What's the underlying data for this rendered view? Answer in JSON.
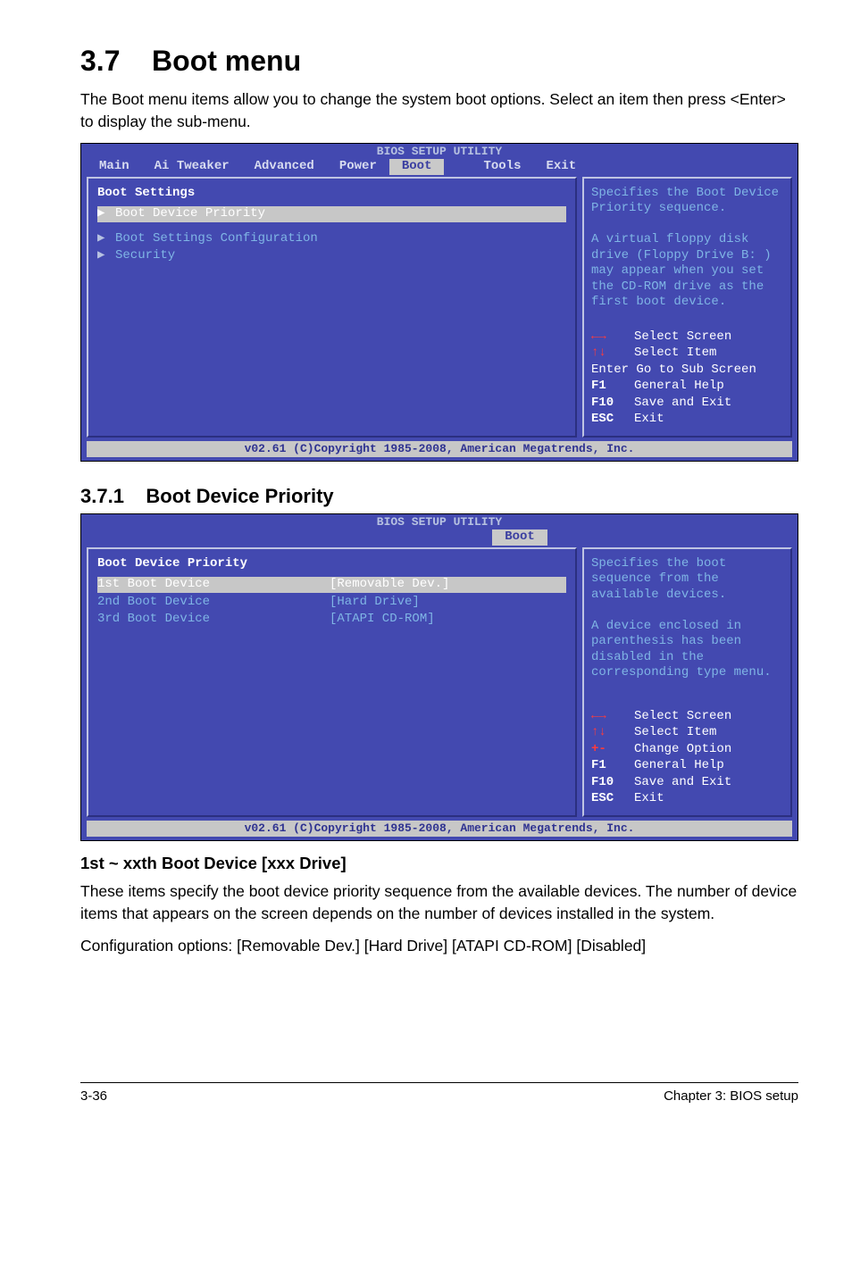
{
  "section": {
    "number": "3.7",
    "title": "Boot menu",
    "intro": "The Boot menu items allow you to change the system boot options. Select an item then press <Enter> to display the sub-menu."
  },
  "bios1": {
    "header": "BIOS SETUP UTILITY",
    "tabs": [
      "Main",
      "Ai Tweaker",
      "Advanced",
      "Power",
      "Boot",
      "Tools",
      "Exit"
    ],
    "active_tab": "Boot",
    "left": {
      "heading": "Boot Settings",
      "items": [
        {
          "pointer": "▶",
          "label": "Boot Device Priority",
          "selected": true
        },
        {
          "pointer": "▶",
          "label": "Boot Settings Configuration",
          "selected": false
        },
        {
          "pointer": "▶",
          "label": "Security",
          "selected": false
        }
      ]
    },
    "help": "Specifies the Boot Device Priority sequence.\n\nA virtual floppy disk drive (Floppy Drive B: ) may appear when you set the CD-ROM drive as the first boot device.",
    "nav": [
      {
        "key": "←→",
        "desc": "Select Screen",
        "arrows": true
      },
      {
        "key": "↑↓",
        "desc": "Select Item",
        "arrows": true
      },
      {
        "key": "Enter",
        "desc": "Go to Sub Screen",
        "arrows": false,
        "inline": true
      },
      {
        "key": "F1",
        "desc": "General Help",
        "arrows": false
      },
      {
        "key": "F10",
        "desc": "Save and Exit",
        "arrows": false
      },
      {
        "key": "ESC",
        "desc": "Exit",
        "arrows": false
      }
    ],
    "footer": "v02.61 (C)Copyright 1985-2008, American Megatrends, Inc."
  },
  "subsection": {
    "number": "3.7.1",
    "title": "Boot Device Priority"
  },
  "bios2": {
    "header": "BIOS SETUP UTILITY",
    "active_tab": "Boot",
    "left": {
      "heading": "Boot Device Priority",
      "rows": [
        {
          "label": "1st Boot Device",
          "value": "[Removable Dev.]",
          "selected": true
        },
        {
          "label": "2nd Boot Device",
          "value": "[Hard Drive]",
          "selected": false
        },
        {
          "label": "3rd Boot Device",
          "value": "[ATAPI CD-ROM]",
          "selected": false
        }
      ]
    },
    "help": "Specifies the boot sequence from the available devices.\n\nA device enclosed in parenthesis has been disabled in the corresponding type menu.",
    "nav": [
      {
        "key": "←→",
        "desc": "Select Screen",
        "arrows": true
      },
      {
        "key": "↑↓",
        "desc": "Select Item",
        "arrows": true
      },
      {
        "key": "+-",
        "desc": "Change Option",
        "arrows": true
      },
      {
        "key": "F1",
        "desc": "General Help",
        "arrows": false
      },
      {
        "key": "F10",
        "desc": "Save and Exit",
        "arrows": false
      },
      {
        "key": "ESC",
        "desc": "Exit",
        "arrows": false
      }
    ],
    "footer": "v02.61 (C)Copyright 1985-2008, American Megatrends, Inc."
  },
  "paragraph": {
    "heading": "1st ~ xxth Boot Device [xxx Drive]",
    "body1": "These items specify the boot device priority sequence from the available devices. The number of device items that appears on the screen depends on the number of devices installed in the system.",
    "body2": "Configuration options: [Removable Dev.] [Hard Drive] [ATAPI CD-ROM] [Disabled]"
  },
  "footer": {
    "left": "3-36",
    "right": "Chapter 3: BIOS setup"
  }
}
